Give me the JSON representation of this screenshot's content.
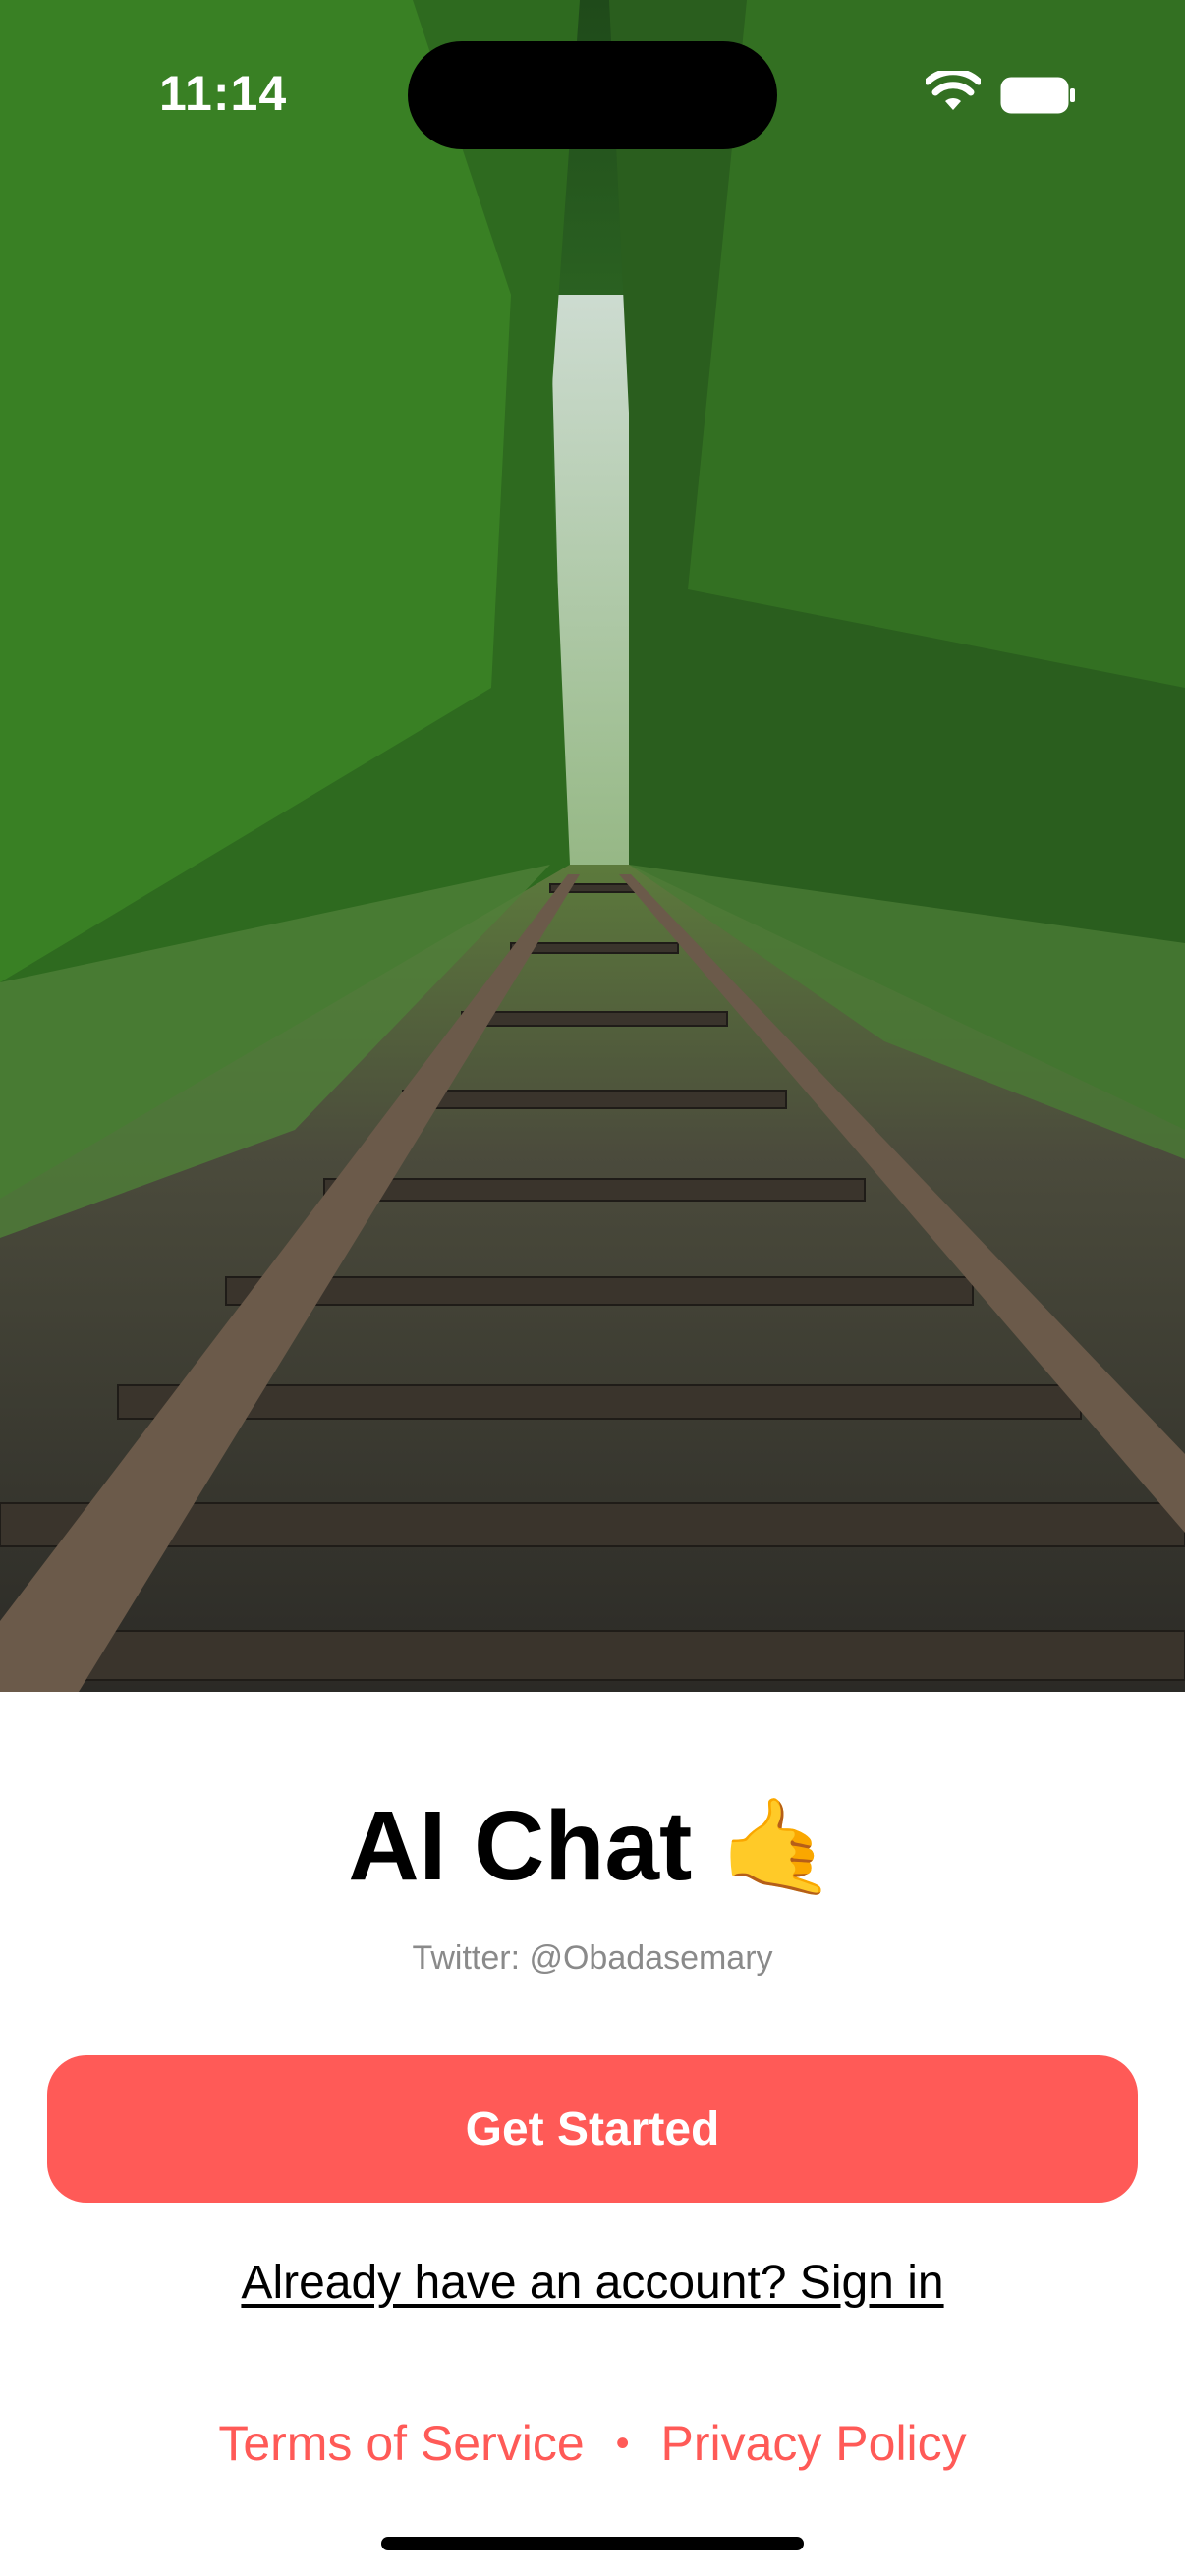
{
  "status_bar": {
    "time": "11:14",
    "icons": [
      "wifi-icon",
      "battery-icon"
    ]
  },
  "hero": {
    "image": "railway-tracks-forest-photo"
  },
  "app": {
    "title": "AI Chat",
    "title_emoji": "🤙",
    "subtitle": "Twitter: @Obadasemary"
  },
  "actions": {
    "get_started_label": "Get Started",
    "signin_label": "Already have an account? Sign in"
  },
  "legal": {
    "terms_label": "Terms of Service",
    "separator": "•",
    "privacy_label": "Privacy Policy"
  },
  "colors": {
    "accent": "#ff5a57",
    "subtitle": "#8a8a8a",
    "background": "#ffffff"
  }
}
